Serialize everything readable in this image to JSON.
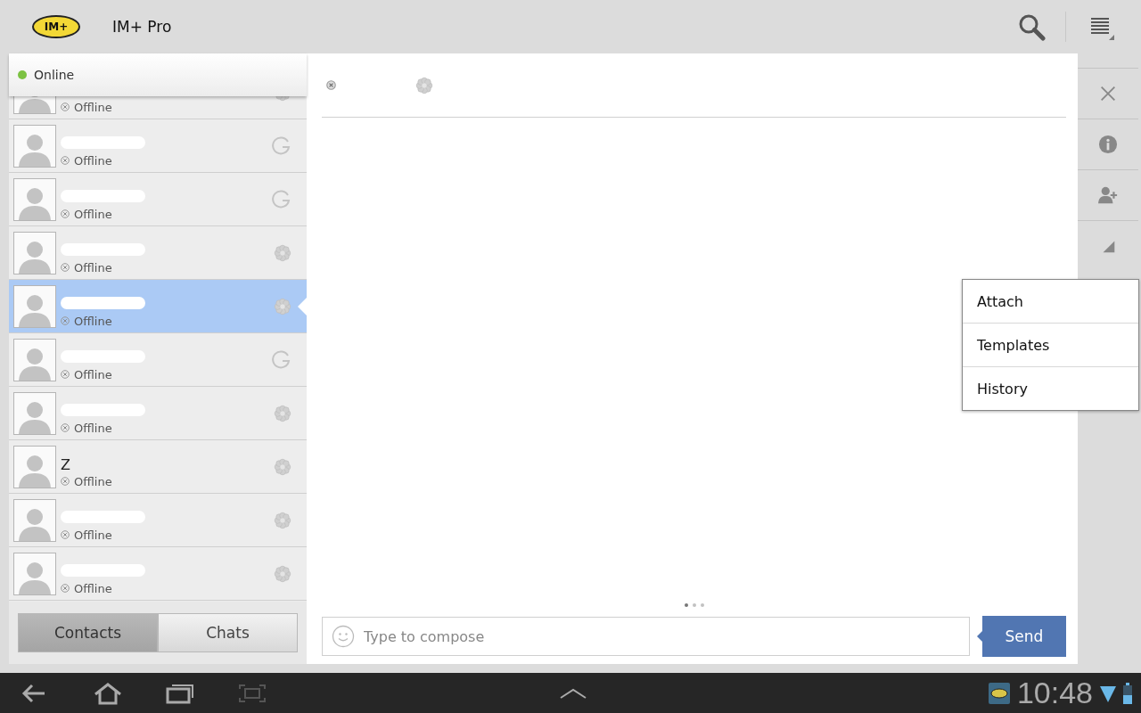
{
  "app_bar": {
    "logo_text": "IM+",
    "title": "IM+ Pro"
  },
  "presence": {
    "label": "Online",
    "color": "#7cc242"
  },
  "contacts": [
    {
      "status": "Offline",
      "kind": "icq",
      "selected": false
    },
    {
      "redacted": true,
      "status": "Offline",
      "kind": "google",
      "selected": false
    },
    {
      "redacted": true,
      "status": "Offline",
      "kind": "google",
      "selected": false
    },
    {
      "redacted": true,
      "status": "Offline",
      "kind": "icq",
      "selected": false
    },
    {
      "redacted": true,
      "status": "Offline",
      "kind": "icq",
      "selected": true
    },
    {
      "redacted": true,
      "status": "Offline",
      "kind": "google",
      "selected": false
    },
    {
      "redacted": true,
      "status": "Offline",
      "kind": "icq",
      "selected": false
    },
    {
      "name": "Z",
      "status": "Offline",
      "kind": "icq",
      "selected": false
    },
    {
      "redacted": true,
      "status": "Offline",
      "kind": "icq",
      "selected": false
    },
    {
      "redacted": true,
      "status": "Offline",
      "kind": "icq",
      "selected": false
    }
  ],
  "list_tabs": [
    {
      "label": "Contacts",
      "selected": true
    },
    {
      "label": "Chats",
      "selected": false
    }
  ],
  "chat": {
    "kind": "icq",
    "pages": [
      {
        "selected": true
      },
      {
        "selected": false
      },
      {
        "selected": false
      }
    ],
    "compose": {
      "placeholder": "Type to compose"
    },
    "send_label": "Send"
  },
  "menu": [
    "Attach",
    "Templates",
    "History"
  ],
  "system_bar": {
    "clock": "10:48"
  }
}
